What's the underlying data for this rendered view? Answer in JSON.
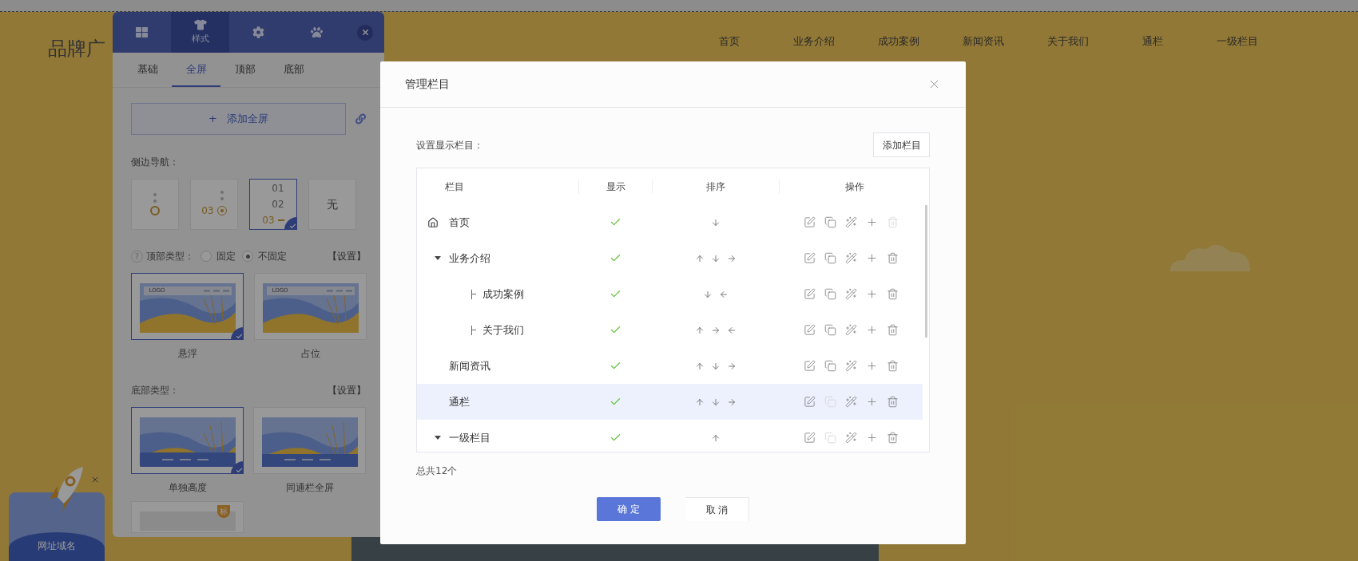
{
  "site": {
    "brand": "品牌广",
    "nav": [
      "首页",
      "业务介绍",
      "成功案例",
      "新闻资讯",
      "关于我们",
      "通栏",
      "一级栏目"
    ]
  },
  "panel": {
    "top_tabs": [
      {
        "kind": "grid",
        "selected": false
      },
      {
        "kind": "shirt",
        "label": "样式",
        "selected": true
      },
      {
        "kind": "gear",
        "selected": false
      },
      {
        "kind": "paw",
        "selected": false
      }
    ],
    "sub_tabs": [
      {
        "label": "基础",
        "selected": false
      },
      {
        "label": "全屏",
        "selected": true
      },
      {
        "label": "顶部",
        "selected": false
      },
      {
        "label": "底部",
        "selected": false
      }
    ],
    "add_button": {
      "icon": "+",
      "label": "添加全屏"
    },
    "side_nav": {
      "label": "侧边导航：",
      "options": [
        {
          "kind": "dots",
          "selected": false
        },
        {
          "kind": "numbered-dot",
          "texts": [
            "03"
          ],
          "selected": false
        },
        {
          "kind": "numbered-list",
          "texts": [
            "01",
            "02",
            "03"
          ],
          "selected": true
        },
        {
          "kind": "text",
          "texts": [
            "无"
          ],
          "selected": false
        }
      ]
    },
    "top_type": {
      "help": "?",
      "label": "顶部类型：",
      "radios": [
        {
          "label": "固定",
          "selected": false
        },
        {
          "label": "不固定",
          "selected": true
        }
      ],
      "setting": "【设置】",
      "cards": [
        {
          "kind": "header",
          "logo": "LOGO",
          "label": "悬浮",
          "selected": true
        },
        {
          "kind": "header",
          "logo": "LOGO",
          "label": "占位",
          "selected": false
        }
      ]
    },
    "bottom_type": {
      "label": "底部类型：",
      "setting": "【设置】",
      "cards": [
        {
          "kind": "footer",
          "label": "单独高度",
          "selected": true
        },
        {
          "kind": "footer-full",
          "label": "同通栏全屏",
          "selected": false
        },
        {
          "kind": "blank",
          "badge": "标",
          "selected": false
        }
      ]
    }
  },
  "promo": {
    "title": "网址域名"
  },
  "dialog": {
    "title": "管理栏目",
    "label": "设置显示栏目：",
    "add_button": "添加栏目",
    "columns": [
      "栏目",
      "显示",
      "排序",
      "操作"
    ],
    "rows": [
      {
        "name": "首页",
        "home": true,
        "shown": true,
        "sort": [
          {
            "kind": "down"
          }
        ],
        "copy_disabled": false,
        "delete_disabled": true,
        "selected": false
      },
      {
        "name": "业务介绍",
        "expanded": true,
        "shown": true,
        "sort": [
          {
            "kind": "up"
          },
          {
            "kind": "down"
          },
          {
            "kind": "right"
          }
        ],
        "copy_disabled": false,
        "delete_disabled": false,
        "selected": false,
        "children": [
          {
            "name": "成功案例",
            "shown": true,
            "sort": [
              {
                "kind": "down"
              },
              {
                "kind": "left"
              }
            ],
            "copy_disabled": false,
            "delete_disabled": false,
            "selected": false
          },
          {
            "name": "关于我们",
            "shown": true,
            "sort": [
              {
                "kind": "up"
              },
              {
                "kind": "right"
              },
              {
                "kind": "left"
              }
            ],
            "copy_disabled": false,
            "delete_disabled": false,
            "selected": false
          }
        ]
      },
      {
        "name": "新闻资讯",
        "shown": true,
        "sort": [
          {
            "kind": "up"
          },
          {
            "kind": "down"
          },
          {
            "kind": "right"
          }
        ],
        "copy_disabled": false,
        "delete_disabled": false,
        "selected": false
      },
      {
        "name": "通栏",
        "shown": true,
        "sort": [
          {
            "kind": "up"
          },
          {
            "kind": "down"
          },
          {
            "kind": "right"
          }
        ],
        "copy_disabled": true,
        "delete_disabled": false,
        "selected": true
      },
      {
        "name": "一级栏目",
        "expanded": true,
        "shown": true,
        "sort": [
          {
            "kind": "up"
          }
        ],
        "copy_disabled": true,
        "delete_disabled": false,
        "selected": false
      }
    ],
    "total": "总共12个",
    "ok": "确 定",
    "cancel": "取 消"
  }
}
